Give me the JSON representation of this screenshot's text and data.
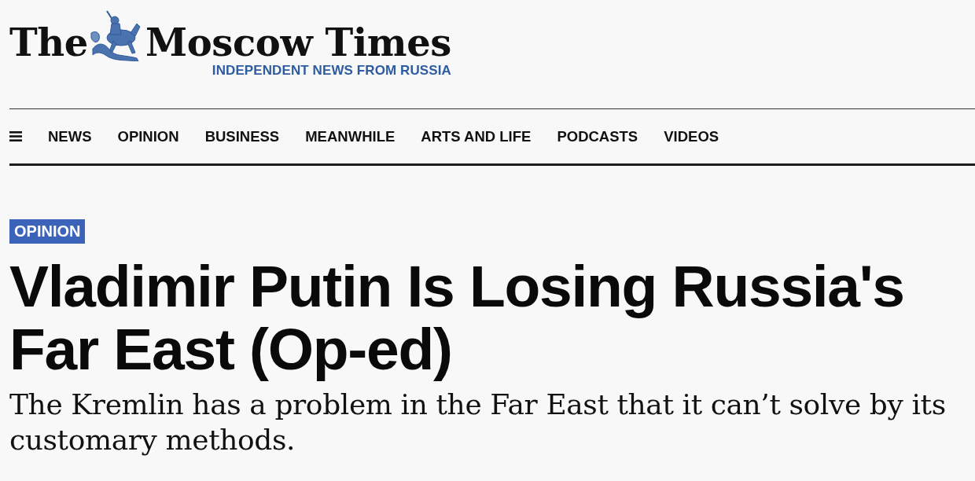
{
  "masthead": {
    "title_before_emblem": "The",
    "title_after_emblem": "Moscow Times",
    "tagline": "INDEPENDENT NEWS FROM RUSSIA"
  },
  "nav": {
    "items": [
      {
        "label": "NEWS"
      },
      {
        "label": "OPINION"
      },
      {
        "label": "BUSINESS"
      },
      {
        "label": "MEANWHILE"
      },
      {
        "label": "ARTS AND LIFE"
      },
      {
        "label": "PODCASTS"
      },
      {
        "label": "VIDEOS"
      }
    ]
  },
  "article": {
    "section_tag": "OPINION",
    "headline": "Vladimir Putin Is Losing Russia's Far East (Op-ed)",
    "subtitle": "The Kremlin has a problem in the Far East that it can’t solve by its customary methods."
  }
}
